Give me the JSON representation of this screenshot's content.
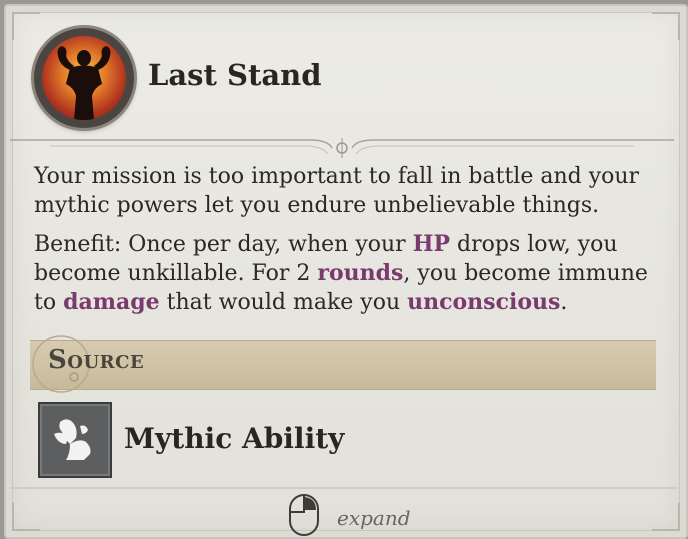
{
  "ability": {
    "title": "Last Stand",
    "portrait_icon": "flexing-warrior-icon"
  },
  "description": {
    "line1": "Your mission is too important to fall in battle and your mythic powers let you endure unbelievable things.",
    "benefit_parts": [
      {
        "text": "Benefit: Once per day, when your ",
        "keyword": false
      },
      {
        "text": "HP",
        "keyword": true
      },
      {
        "text": " drops low, you become unkillable. For 2 ",
        "keyword": false
      },
      {
        "text": "rounds",
        "keyword": true
      },
      {
        "text": ", you become immune to ",
        "keyword": false
      },
      {
        "text": "damage",
        "keyword": true
      },
      {
        "text": " that would make you ",
        "keyword": false
      },
      {
        "text": "unconscious",
        "keyword": true
      },
      {
        "text": ".",
        "keyword": false
      }
    ]
  },
  "source": {
    "header": "Source",
    "item_label": "Mythic Ability",
    "item_icon": "winged-emblem-icon"
  },
  "footer": {
    "hint_icon": "mouse-icon",
    "hint_label": "expand"
  },
  "colors": {
    "keyword": "#7a3a6e",
    "parchment": "#e7e6e0",
    "source_bar": "#cfc3a5"
  }
}
